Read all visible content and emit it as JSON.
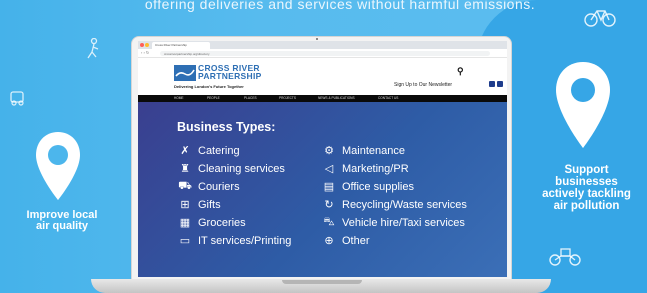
{
  "headline": "offering deliveries and services without harmful emissions.",
  "left_callout": {
    "line1": "Improve local",
    "line2": "air quality"
  },
  "right_callout": {
    "line1": "Support",
    "line2": "businesses",
    "line3": "actively tackling",
    "line4": "air pollution"
  },
  "colors": {
    "background": "#4cb6ec",
    "panel_right": "#36a6e6",
    "brand_blue": "#2e6fb4",
    "content_bg": "#2e5ca6"
  },
  "browser": {
    "tab_title": "Cross River Partnership",
    "address": "crossriverpartnership.org/directory"
  },
  "site": {
    "logo_line1": "CROSS RIVER",
    "logo_line2": "PARTNERSHIP",
    "tagline": "Delivering London's Future Together",
    "signup": "Sign Up to Our Newsletter",
    "nav": [
      "HOME",
      "PEOPLE",
      "PLACES",
      "PROJECTS",
      "NEWS & PUBLICATIONS",
      "CONTACT US"
    ]
  },
  "directory": {
    "title": "Business Types:",
    "left": [
      {
        "label": "Catering",
        "icon": "utensils-icon"
      },
      {
        "label": "Cleaning services",
        "icon": "spray-bottle-icon"
      },
      {
        "label": "Couriers",
        "icon": "truck-icon"
      },
      {
        "label": "Gifts",
        "icon": "gift-icon"
      },
      {
        "label": "Groceries",
        "icon": "basket-icon"
      },
      {
        "label": "IT services/Printing",
        "icon": "laptop-icon"
      }
    ],
    "right": [
      {
        "label": "Maintenance",
        "icon": "gear-icon"
      },
      {
        "label": "Marketing/PR",
        "icon": "megaphone-icon"
      },
      {
        "label": "Office supplies",
        "icon": "document-icon"
      },
      {
        "label": "Recycling/Waste services",
        "icon": "recycle-icon"
      },
      {
        "label": "Vehicle hire/Taxi services",
        "icon": "car-icon"
      },
      {
        "label": "Other",
        "icon": "plus-circle-icon"
      }
    ]
  }
}
